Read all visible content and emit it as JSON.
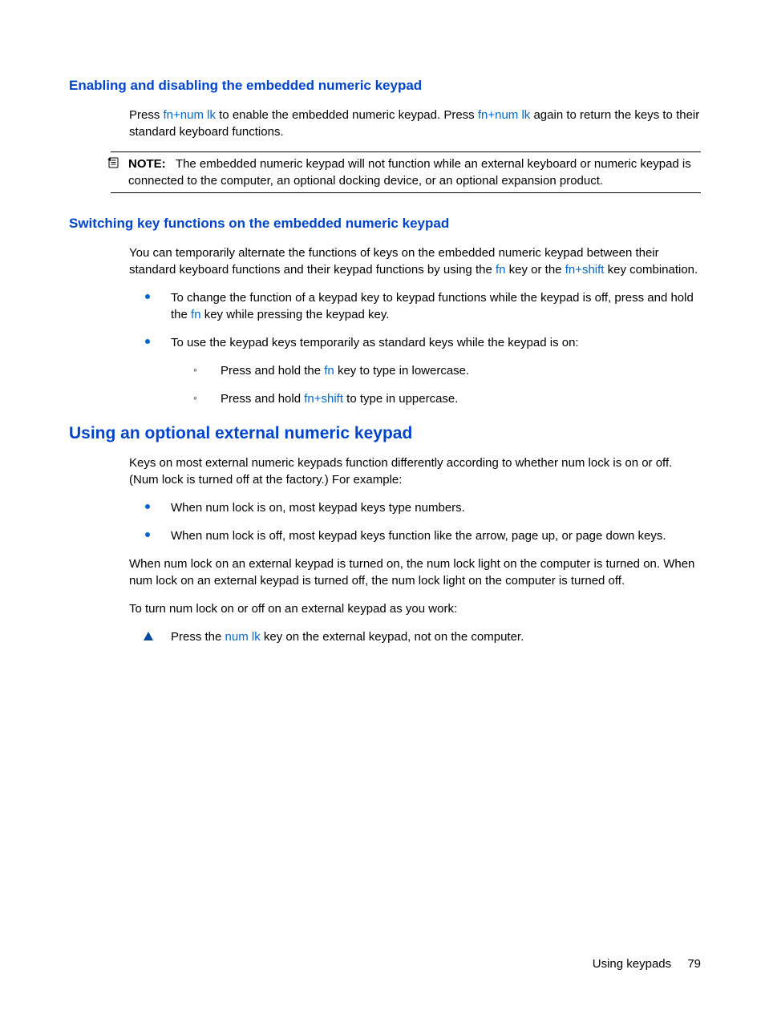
{
  "section1": {
    "title": "Enabling and disabling the embedded numeric keypad",
    "p1a": "Press ",
    "k1": "fn+num lk",
    "p1b": " to enable the embedded numeric keypad. Press ",
    "k2": "fn+num lk",
    "p1c": " again to return the keys to their standard keyboard functions.",
    "note_label": "NOTE:",
    "note_text": "The embedded numeric keypad will not function while an external keyboard or numeric keypad is connected to the computer, an optional docking device, or an optional expansion product."
  },
  "section2": {
    "title": "Switching key functions on the embedded numeric keypad",
    "p1a": "You can temporarily alternate the functions of keys on the embedded numeric keypad between their standard keyboard functions and their keypad functions by using the ",
    "k1": "fn",
    "p1b": " key or the ",
    "k2": "fn+shift",
    "p1c": " key combination.",
    "b1a": "To change the function of a keypad key to keypad functions while the keypad is off, press and hold the ",
    "b1k": "fn",
    "b1b": " key while pressing the keypad key.",
    "b2": "To use the keypad keys temporarily as standard keys while the keypad is on:",
    "b2s1a": "Press and hold the ",
    "b2s1k": "fn",
    "b2s1b": " key to type in lowercase.",
    "b2s2a": "Press and hold ",
    "b2s2k": "fn+shift",
    "b2s2b": " to type in uppercase."
  },
  "section3": {
    "title": "Using an optional external numeric keypad",
    "p1": "Keys on most external numeric keypads function differently according to whether num lock is on or off. (Num lock is turned off at the factory.) For example:",
    "b1": "When num lock is on, most keypad keys type numbers.",
    "b2": "When num lock is off, most keypad keys function like the arrow, page up, or page down keys.",
    "p2": "When num lock on an external keypad is turned on, the num lock light on the computer is turned on. When num lock on an external keypad is turned off, the num lock light on the computer is turned off.",
    "p3": "To turn num lock on or off on an external keypad as you work:",
    "t1a": "Press the ",
    "t1k": "num lk",
    "t1b": " key on the external keypad, not on the computer."
  },
  "footer": {
    "section": "Using keypads",
    "page": "79"
  }
}
